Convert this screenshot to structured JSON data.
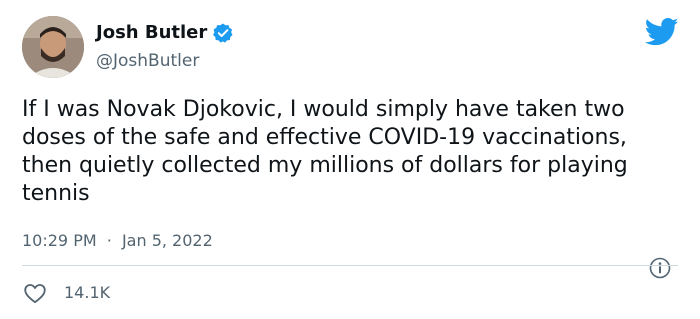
{
  "author": {
    "display_name": "Josh Butler",
    "handle": "@JoshButler",
    "verified_icon": "verified-badge-icon",
    "avatar_icon": "avatar"
  },
  "tweet": {
    "text": "If I was Novak Djokovic, I would simply have taken two doses of the safe and effective COVID-19 vaccinations, then quietly collected my millions of dollars for playing tennis",
    "time": "10:29 PM",
    "separator": "·",
    "date": "Jan 5, 2022"
  },
  "engagement": {
    "likes": "14.1K",
    "like_icon": "heart-icon",
    "info_icon": "info-icon"
  },
  "brand": {
    "icon": "twitter-bird-icon",
    "accent_color": "#1d9bf0",
    "text_color": "#0f1419",
    "secondary_text_color": "#536471"
  }
}
